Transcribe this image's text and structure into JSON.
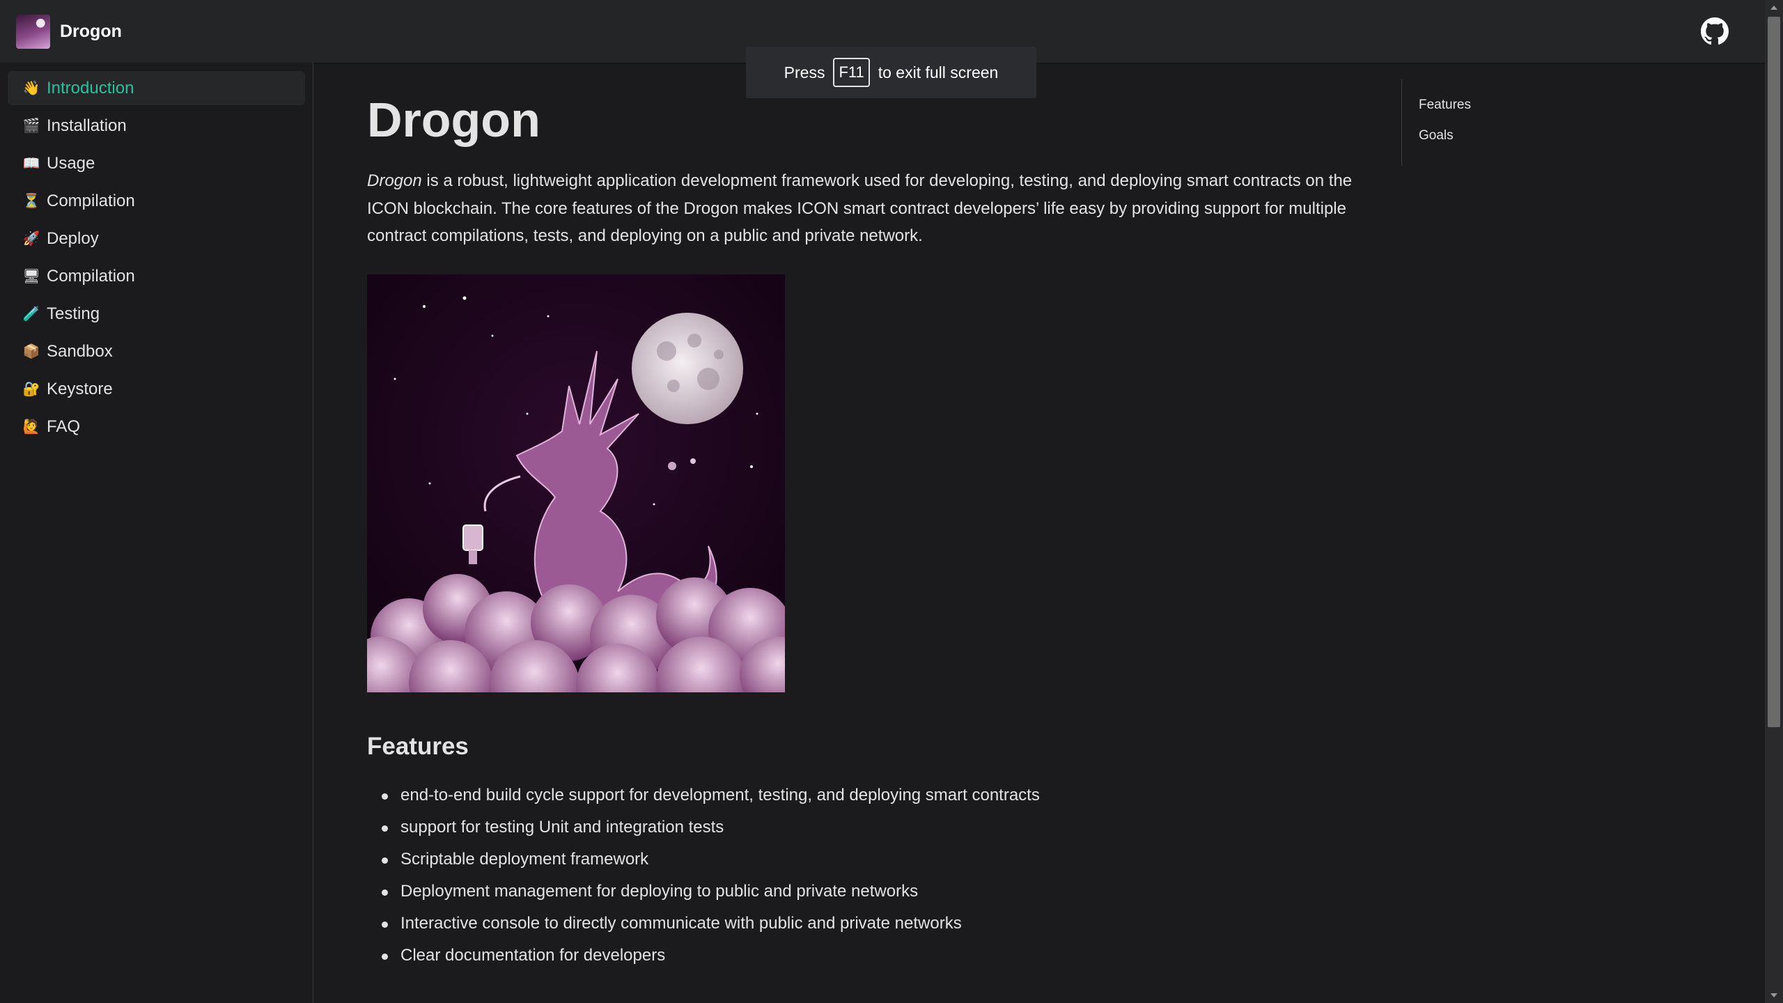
{
  "navbar": {
    "title": "Drogon",
    "github_icon": "github-icon"
  },
  "toast": {
    "prefix": "Press",
    "key": "F11",
    "suffix": "to exit full screen"
  },
  "sidebar": {
    "items": [
      {
        "label": "Introduction",
        "icon": "👋",
        "active": true
      },
      {
        "label": "Installation",
        "icon": "🎬"
      },
      {
        "label": "Usage",
        "icon": "📖"
      },
      {
        "label": "Compilation",
        "icon": "⏳"
      },
      {
        "label": "Deploy",
        "icon": "🚀"
      },
      {
        "label": "Compilation",
        "icon": "🖥"
      },
      {
        "label": "Testing",
        "icon": "🧪"
      },
      {
        "label": "Sandbox",
        "icon": "📦"
      },
      {
        "label": "Keystore",
        "icon": "🔐"
      },
      {
        "label": "FAQ",
        "icon": "🙋"
      }
    ]
  },
  "main": {
    "title": "Drogon",
    "intro_em": "Drogon",
    "intro_rest": " is a robust, lightweight application development framework used for developing, testing, and deploying smart contracts on the ICON blockchain. The core features of the Drogon makes ICON smart contract developers’ life easy by providing support for multiple contract compilations, tests, and deploying on a public and private network.",
    "features_title": "Features",
    "features": [
      "end-to-end build cycle support for development, testing, and deploying smart contracts",
      "support for testing Unit and integration tests",
      "Scriptable deployment framework",
      "Deployment management for deploying to public and private networks",
      "Interactive console to directly communicate with public and private networks",
      "Clear documentation for developers"
    ]
  },
  "toc": {
    "items": [
      "Features",
      "Goals"
    ]
  },
  "colors": {
    "accent": "#25c2a0",
    "background": "#1b1b1d",
    "navbar": "#242526"
  }
}
